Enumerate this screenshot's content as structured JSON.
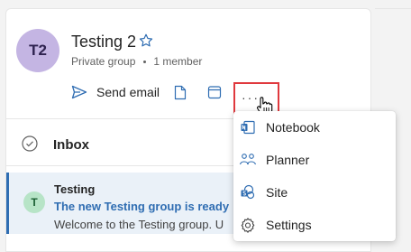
{
  "group": {
    "avatar_initials": "T2",
    "name": "Testing 2",
    "privacy": "Private group",
    "member_count": "1 member"
  },
  "actions": {
    "send_email_label": "Send email",
    "more_label": "···"
  },
  "inbox": {
    "label": "Inbox"
  },
  "message": {
    "avatar_initial": "T",
    "from": "Testing",
    "subject": "The new Testing group is ready",
    "preview": "Welcome to the Testing group. U"
  },
  "menu": {
    "items": [
      {
        "label": "Notebook",
        "icon": "notebook-icon"
      },
      {
        "label": "Planner",
        "icon": "planner-icon"
      },
      {
        "label": "Site",
        "icon": "site-icon"
      },
      {
        "label": "Settings",
        "icon": "settings-icon"
      }
    ]
  },
  "colors": {
    "accent": "#2f6db2",
    "highlight_box": "#e0393e",
    "group_avatar": "#c4b5e3",
    "message_avatar": "#b7e4c7"
  }
}
